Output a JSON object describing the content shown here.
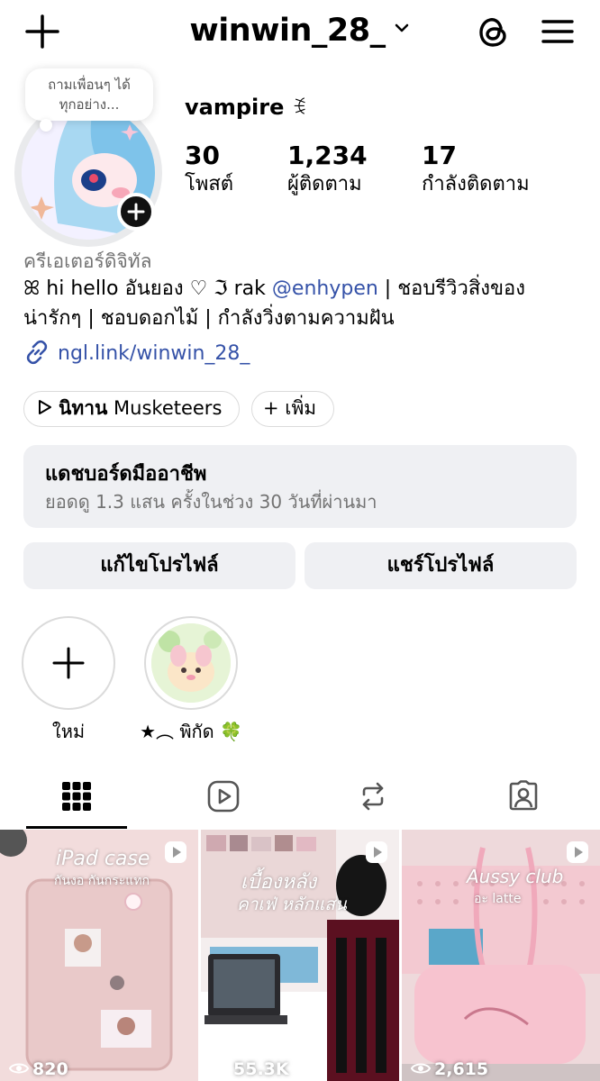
{
  "header": {
    "username": "winwin_28_"
  },
  "note": {
    "line1": "ถามเพื่อนๆ ได้",
    "line2": "ทุกอย่าง..."
  },
  "profile": {
    "display_name": "vampire",
    "name_symbol": "ꉂ",
    "stats": [
      {
        "value": "30",
        "label": "โพสต์"
      },
      {
        "value": "1,234",
        "label": "ผู้ติดตาม"
      },
      {
        "value": "17",
        "label": "กำลังติดตาม"
      }
    ],
    "category": "ครีเอเตอร์ดิจิทัล",
    "bio_part1": "ꕤ hi hello อันยอง ♡ ℑ rak ",
    "bio_mention": "@enhypen",
    "bio_part2": " | ชอบรีวิวสิ่งของ",
    "bio_line2": "น่ารักๆ | ชอบดอกไม้ | กำลังวิ่งตามความฝัน",
    "link": "ngl.link/winwin_28_"
  },
  "chips": {
    "music_bold": "นิทาน",
    "music_rest": " Musketeers",
    "add_label": "+ เพิ่ม"
  },
  "dashboard": {
    "title": "แดชบอร์ดมืออาชีพ",
    "subtitle": "ยอดดู 1.3 แสน ครั้งในช่วง 30 วันที่ผ่านมา"
  },
  "buttons": {
    "edit": "แก้ไขโปรไฟล์",
    "share": "แชร์โปรไฟล์"
  },
  "highlights": [
    {
      "label": "ใหม่"
    },
    {
      "label": "★︵ พิกัด 🍀"
    }
  ],
  "posts": [
    {
      "views": "820",
      "title": "iPad case",
      "subtitle": "กันงอ กันกระแทก"
    },
    {
      "views": "55.3K",
      "title": "เบื้องหลัง",
      "subtitle": "คาเฟ่ หลักแสน"
    },
    {
      "views": "2,615",
      "title": "Aussy club",
      "subtitle": "อะ latte"
    }
  ],
  "colors": {
    "link": "#3552a8",
    "secondary_text": "#737373",
    "button_bg": "#eff0f3"
  }
}
